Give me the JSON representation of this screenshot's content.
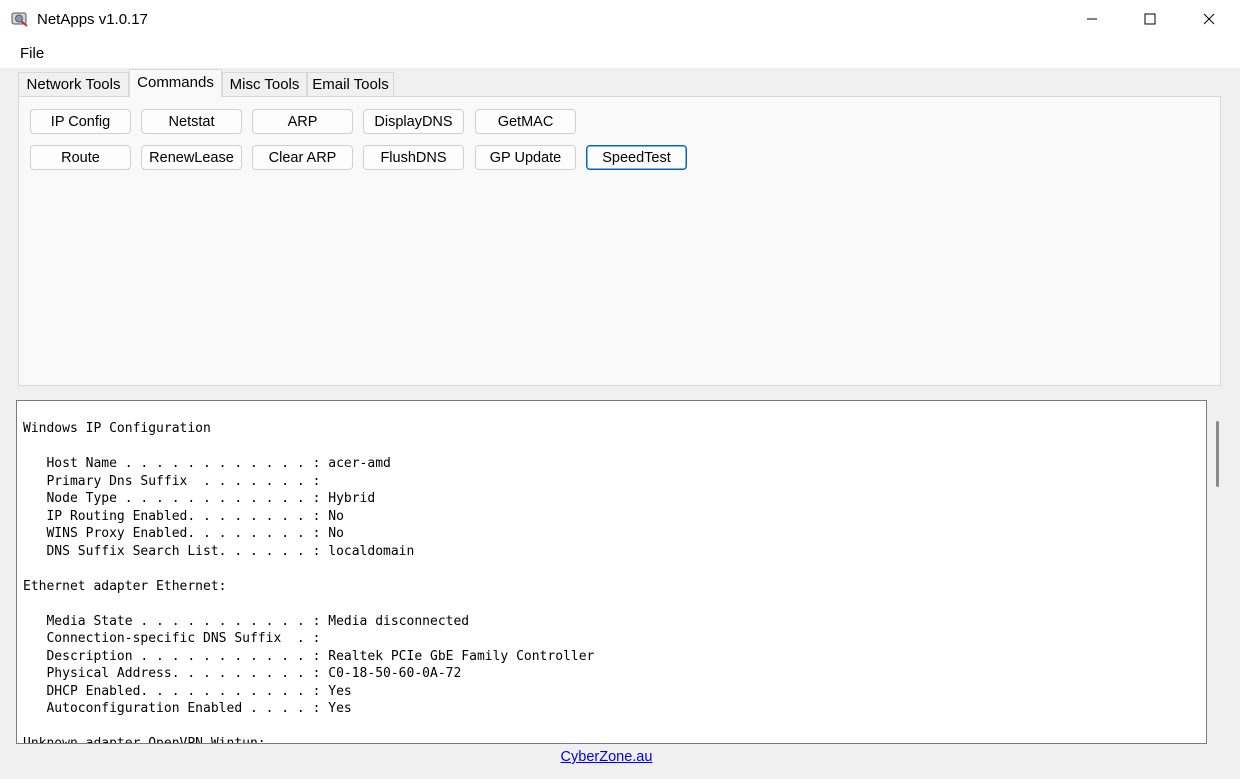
{
  "window": {
    "title": "NetApps v1.0.17",
    "app_icon": "network-tools-icon"
  },
  "menu": {
    "file_label": "File"
  },
  "tabs": [
    {
      "label": "Network Tools"
    },
    {
      "label": "Commands",
      "active": true
    },
    {
      "label": "Misc Tools"
    },
    {
      "label": "Email Tools"
    }
  ],
  "commands": {
    "row1": [
      "IP Config",
      "Netstat",
      "ARP",
      "DisplayDNS",
      "GetMAC"
    ],
    "row2": [
      "Route",
      "RenewLease",
      "Clear ARP",
      "FlushDNS",
      "GP Update",
      "SpeedTest"
    ],
    "focused": "SpeedTest"
  },
  "output": {
    "text": "Windows IP Configuration\n\n   Host Name . . . . . . . . . . . . : acer-amd\n   Primary Dns Suffix  . . . . . . . :\n   Node Type . . . . . . . . . . . . : Hybrid\n   IP Routing Enabled. . . . . . . . : No\n   WINS Proxy Enabled. . . . . . . . : No\n   DNS Suffix Search List. . . . . . : localdomain\n\nEthernet adapter Ethernet:\n\n   Media State . . . . . . . . . . . : Media disconnected\n   Connection-specific DNS Suffix  . :\n   Description . . . . . . . . . . . : Realtek PCIe GbE Family Controller\n   Physical Address. . . . . . . . . : C0-18-50-60-0A-72\n   DHCP Enabled. . . . . . . . . . . : Yes\n   Autoconfiguration Enabled . . . . : Yes\n\nUnknown adapter OpenVPN Wintun:"
  },
  "footer": {
    "link_text": "CyberZone.au"
  },
  "colors": {
    "accent": "#0067c0",
    "link": "#0000ee"
  }
}
